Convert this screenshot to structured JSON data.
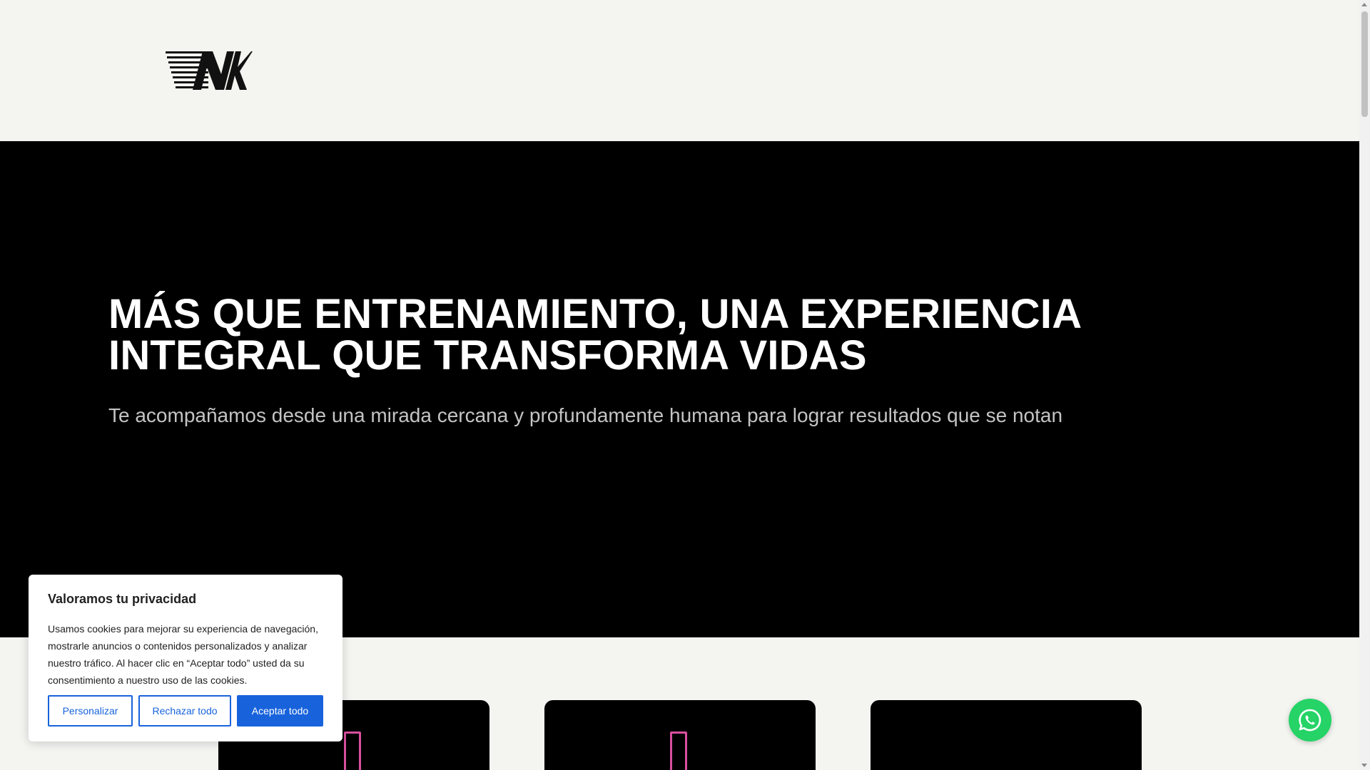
{
  "header": {
    "logo_text": "NK"
  },
  "hero": {
    "title": "MÁS QUE ENTRENAMIENTO, UNA EXPERIENCIA INTEGRAL QUE TRANSFORMA VIDAS",
    "subtitle": "Te acompañamos desde una mirada cercana y profundamente humana para lograr resultados que se notan"
  },
  "cards": [
    {
      "icon": "phone-icon"
    },
    {
      "icon": "phone-icon"
    },
    {
      "icon": ""
    }
  ],
  "cookie_banner": {
    "title": "Valoramos tu privacidad",
    "text": "Usamos cookies para mejorar su experiencia de navegación, mostrarle anuncios o contenidos personalizados y analizar nuestro tráfico. Al hacer clic en “Aceptar todo” usted da su consentimiento a nuestro uso de las cookies.",
    "buttons": {
      "customize": "Personalizar",
      "reject": "Rechazar todo",
      "accept": "Aceptar todo"
    }
  },
  "whatsapp": {
    "icon": "whatsapp-icon"
  },
  "colors": {
    "page_bg": "#f4f4f1",
    "hero_bg": "#000000",
    "accent_pink": "#d94f9f",
    "cookie_blue": "#1863dc",
    "whatsapp_green": "#25d366"
  }
}
